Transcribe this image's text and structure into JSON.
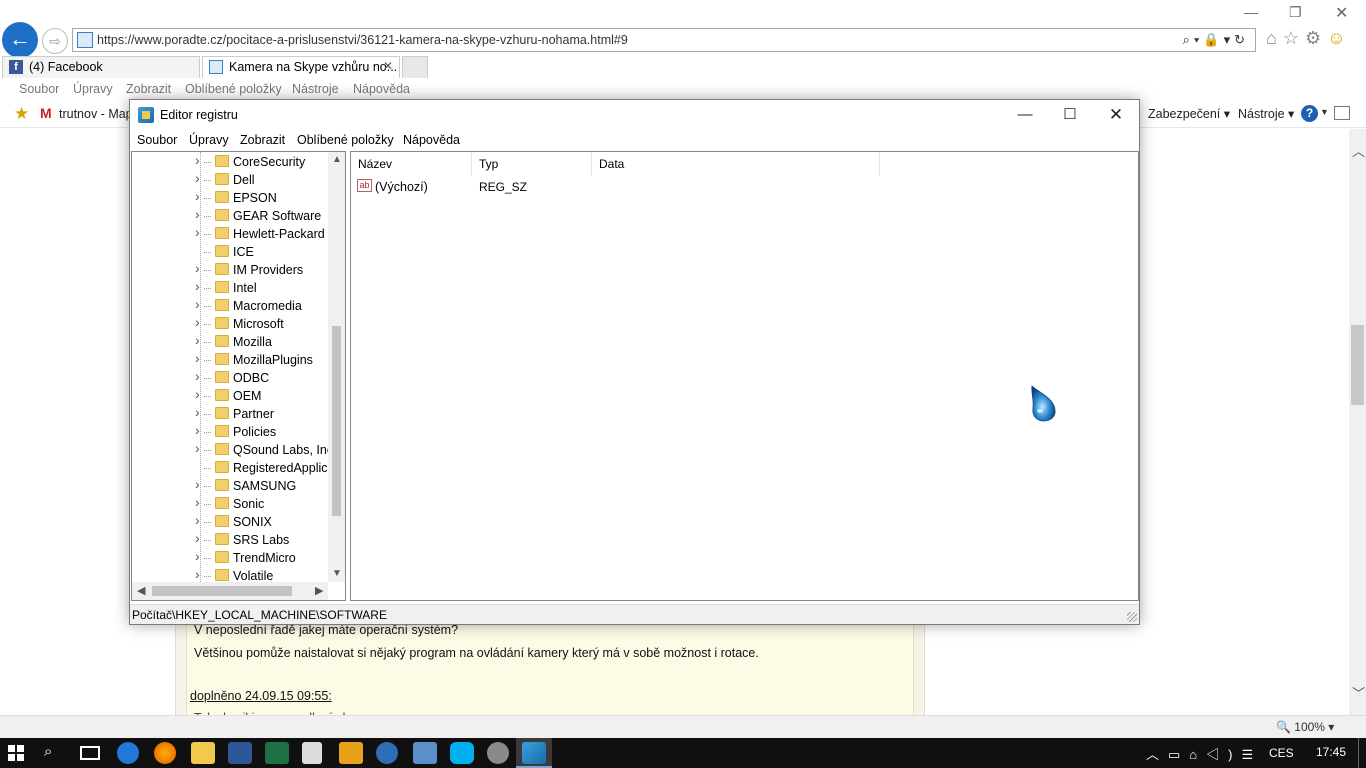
{
  "browser": {
    "url": "https://www.poradte.cz/pocitace-a-prislusenstvi/36121-kamera-na-skype-vzhuru-nohama.html#9",
    "tabs": [
      {
        "label": "(4) Facebook"
      },
      {
        "label": "Kamera na Skype vzhůru no..."
      }
    ],
    "menu": [
      "Soubor",
      "Úpravy",
      "Zobrazit",
      "Oblíbené položky",
      "Nástroje",
      "Nápověda"
    ],
    "favorites": {
      "gmail": "M",
      "trutnov": "trutnov - Map"
    },
    "command_bar": {
      "security": "Zabezpečení ▾",
      "tools": "Nástroje ▾",
      "help": "?"
    },
    "zoom": "🔍 100%  ▾"
  },
  "page": {
    "line1": "V neposlední řadě jakej máte operační systém?",
    "line2": "Většinou pomůže naistalovat si nějaký program na ovládání kamery který má v sobě možnost i rotace.",
    "addendum": "doplněno 24.09.15 09:55:",
    "cut_line": "Tak zkusil jsem zrcadlení obrazu..."
  },
  "regedit": {
    "title": "Editor registru",
    "menu": [
      "Soubor",
      "Úpravy",
      "Zobrazit",
      "Oblíbené položky",
      "Nápověda"
    ],
    "tree": [
      {
        "label": "CoreSecurity",
        "expandable": true
      },
      {
        "label": "Dell",
        "expandable": true
      },
      {
        "label": "EPSON",
        "expandable": true
      },
      {
        "label": "GEAR Software",
        "expandable": true
      },
      {
        "label": "Hewlett-Packard",
        "expandable": true
      },
      {
        "label": "ICE",
        "expandable": false
      },
      {
        "label": "IM Providers",
        "expandable": true
      },
      {
        "label": "Intel",
        "expandable": true
      },
      {
        "label": "Macromedia",
        "expandable": true
      },
      {
        "label": "Microsoft",
        "expandable": true
      },
      {
        "label": "Mozilla",
        "expandable": true
      },
      {
        "label": "MozillaPlugins",
        "expandable": true
      },
      {
        "label": "ODBC",
        "expandable": true
      },
      {
        "label": "OEM",
        "expandable": true
      },
      {
        "label": "Partner",
        "expandable": true
      },
      {
        "label": "Policies",
        "expandable": true
      },
      {
        "label": "QSound Labs, Inc.",
        "expandable": true
      },
      {
        "label": "RegisteredApplica",
        "expandable": false
      },
      {
        "label": "SAMSUNG",
        "expandable": true
      },
      {
        "label": "Sonic",
        "expandable": true
      },
      {
        "label": "SONIX",
        "expandable": true
      },
      {
        "label": "SRS Labs",
        "expandable": true
      },
      {
        "label": "TrendMicro",
        "expandable": true
      },
      {
        "label": "Volatile",
        "expandable": true
      }
    ],
    "columns": {
      "name": "Název",
      "type": "Typ",
      "data": "Data"
    },
    "values": [
      {
        "icon": "ab",
        "name": "(Výchozí)",
        "type": "REG_SZ",
        "data": ""
      }
    ],
    "status_path": "Počítač\\HKEY_LOCAL_MACHINE\\SOFTWARE"
  },
  "taskbar": {
    "language": "CES",
    "clock": "17:45"
  },
  "colors": {
    "ie_back": "#1e6fc7",
    "folder": "#f2cf6b",
    "taskbar": "#101010"
  }
}
